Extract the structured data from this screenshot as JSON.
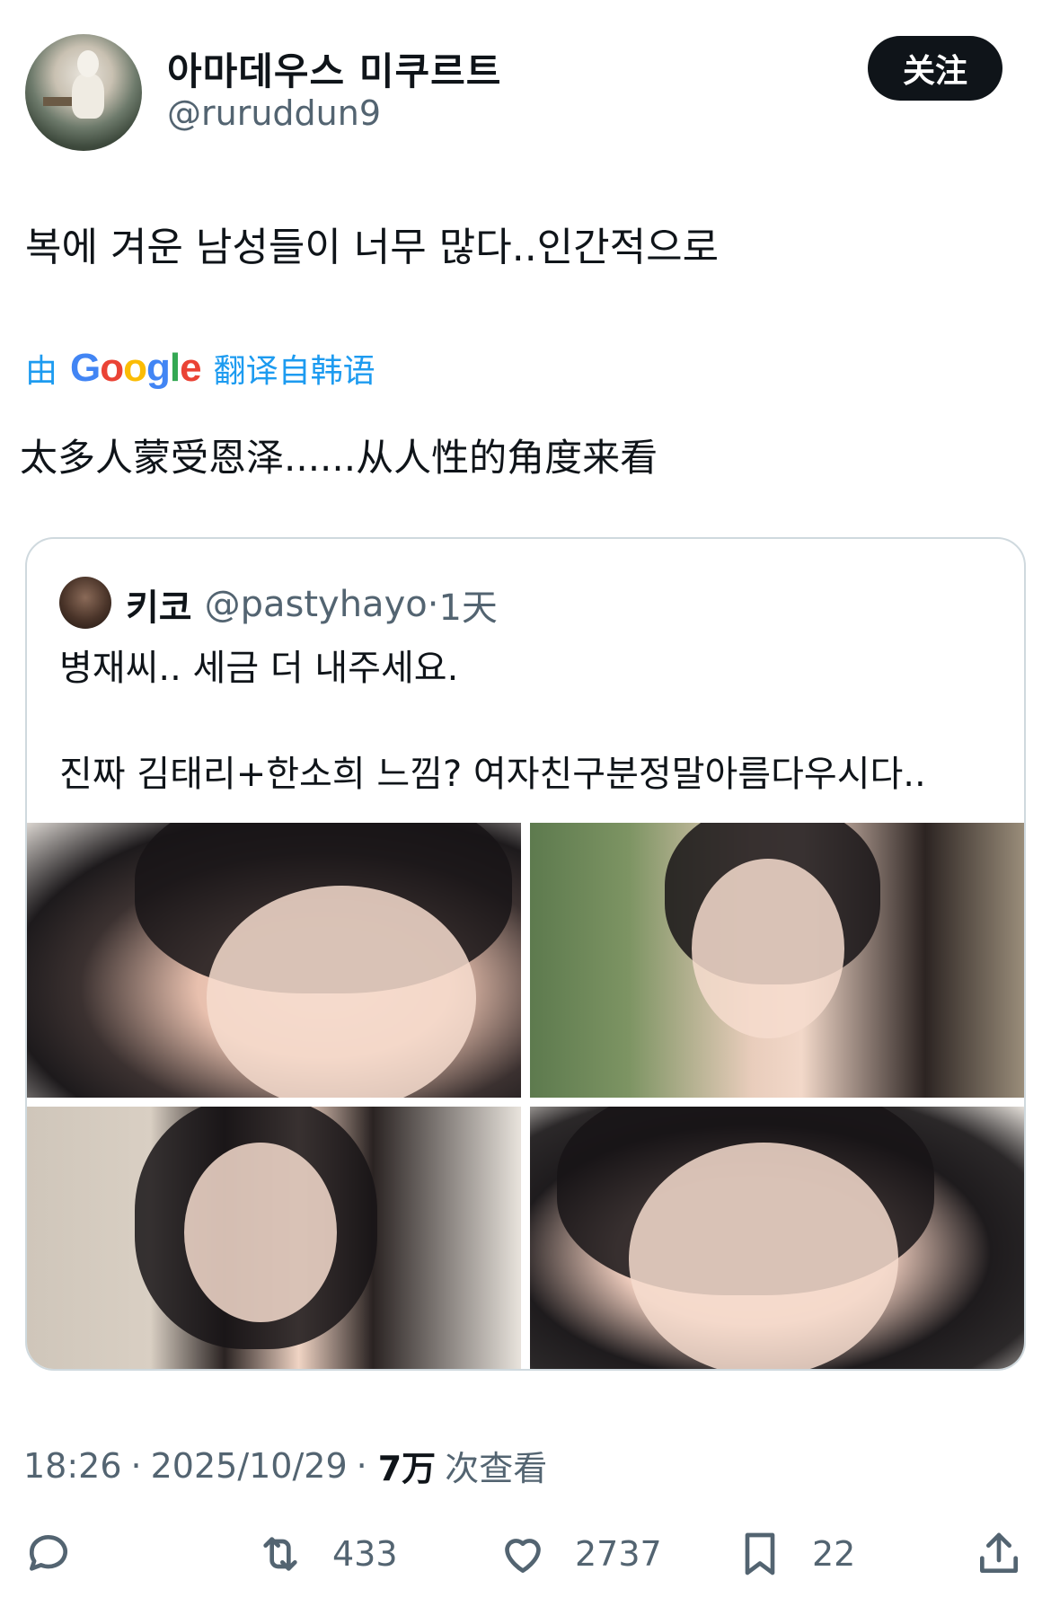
{
  "author": {
    "display_name": "아마데우스 미쿠르트",
    "handle": "@ruruddun9"
  },
  "follow_button": "关注",
  "tweet": {
    "text": "복에 겨운 남성들이 너무 많다..인간적으로",
    "translate_prefix": "由",
    "translate_brand": "Google",
    "translate_suffix": "翻译自韩语",
    "translated_text": "太多人蒙受恩泽......从人性的角度来看"
  },
  "quote": {
    "name": "키코",
    "handle": "@pastyhayo",
    "separator": "·",
    "time": "1天",
    "line1": "병재씨.. 세금 더 내주세요.",
    "line2": "진짜 김태리+한소희 느낌? 여자친구분정말아름다우시다..",
    "photos": [
      "photo-1",
      "photo-2",
      "photo-3",
      "photo-4"
    ]
  },
  "meta": {
    "time": "18:26",
    "date": "2025/10/29",
    "separator": "·",
    "views": "7万",
    "views_label": "次查看"
  },
  "actions": {
    "reply_icon": "reply-icon",
    "retweet_icon": "retweet-icon",
    "retweets": "433",
    "like_icon": "heart-icon",
    "likes": "2737",
    "bookmark_icon": "bookmark-icon",
    "bookmarks": "22",
    "share_icon": "share-icon"
  },
  "colors": {
    "link": "#1d9bf0",
    "secondary_text": "#536471",
    "primary_text": "#0f1419",
    "border": "#cfd9de"
  }
}
